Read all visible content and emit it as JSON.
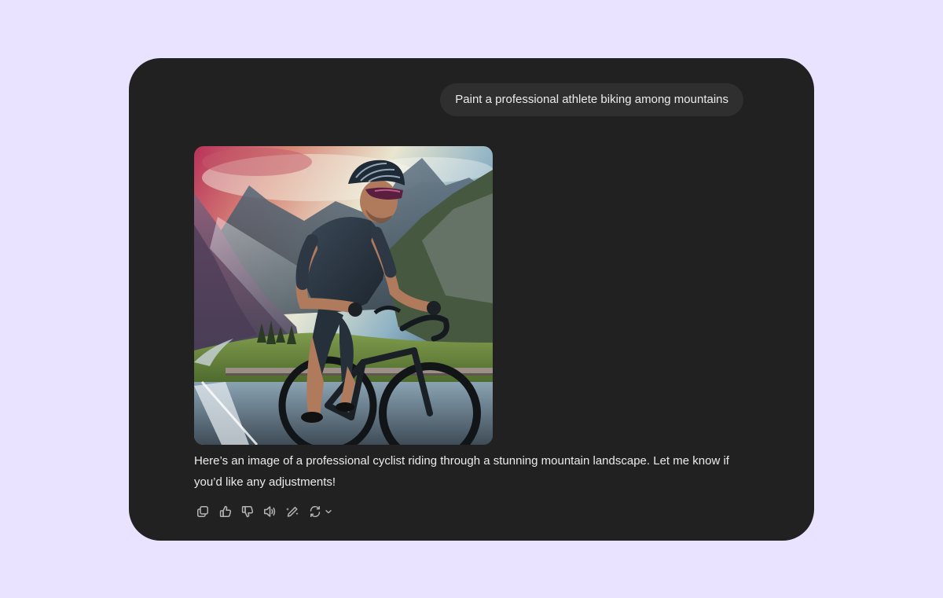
{
  "conversation": {
    "user_message": "Paint a professional athlete biking among mountains",
    "assistant": {
      "image_icon": "generated-cyclist-image",
      "text": "Here’s an image of a professional cyclist riding through a stunning mountain landscape. Let me know if you’d like any adjustments!"
    }
  },
  "actions": {
    "icons": [
      "copy-icon",
      "thumbs-up-icon",
      "thumbs-down-icon",
      "read-aloud-icon",
      "edit-image-icon",
      "regenerate-icon",
      "chevron-down-icon"
    ]
  },
  "colors": {
    "page_background": "#e9e3ff",
    "window_background": "#212121",
    "bubble_background": "#2f2f2f",
    "text": "#ececec",
    "icon": "#b4b4b4"
  }
}
